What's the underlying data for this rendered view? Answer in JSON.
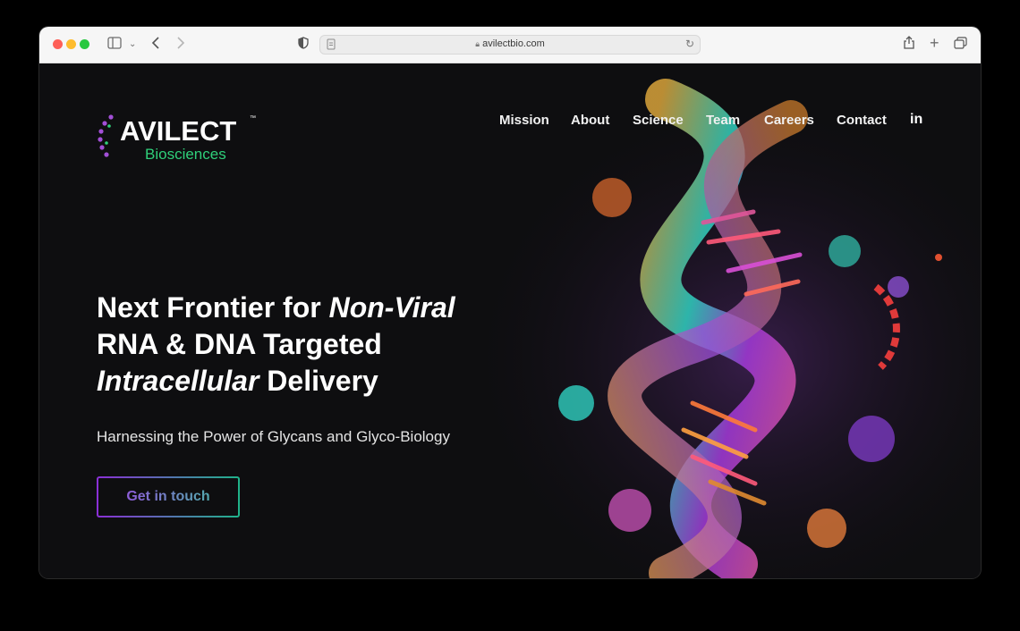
{
  "browser": {
    "url": "avilectbio.com"
  },
  "brand": {
    "name": "AVILECT",
    "subtitle": "Biosciences",
    "tm": "™"
  },
  "nav": {
    "items": [
      "Mission",
      "About",
      "Science",
      "Team",
      "Careers",
      "Contact"
    ],
    "social": "in"
  },
  "hero": {
    "line1_prefix": "Next Frontier for ",
    "line1_em": "Non-Viral",
    "line2": "RNA & DNA Targeted",
    "line3_em": "Intracellular",
    "line3_suffix": " Delivery",
    "subheading": "Harnessing the Power of Glycans and Glyco-Biology",
    "cta_label": "Get in touch"
  },
  "colors": {
    "accent_green": "#2fd07a",
    "accent_purple": "#8b2fd6",
    "background": "#0e0e10"
  }
}
